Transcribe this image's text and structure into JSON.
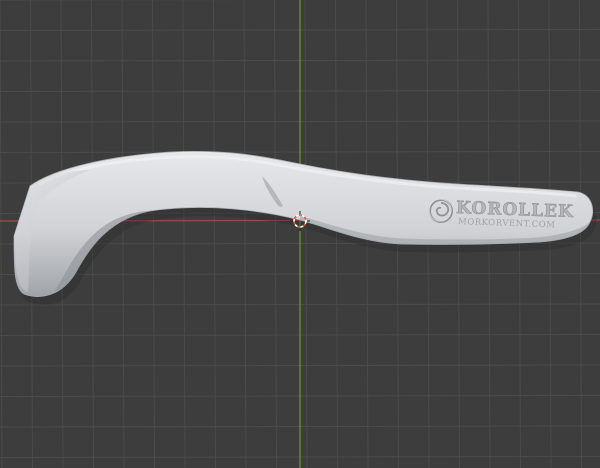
{
  "viewport": {
    "name": "3D Viewport",
    "background": "#3d3d3d",
    "grid_color": "#4b4b4b",
    "axis_x_color": "#a24a4f",
    "axis_y_color": "#6a9a2e"
  },
  "object": {
    "type": "sculpted mesh",
    "color": "#d0d2d5",
    "embossed_logo": {
      "brand": "KOROLLEK",
      "site": "MORKORVENT.COM"
    }
  },
  "cursor_3d": {
    "icon": "3d-cursor-icon",
    "color": "#d45d2b"
  }
}
